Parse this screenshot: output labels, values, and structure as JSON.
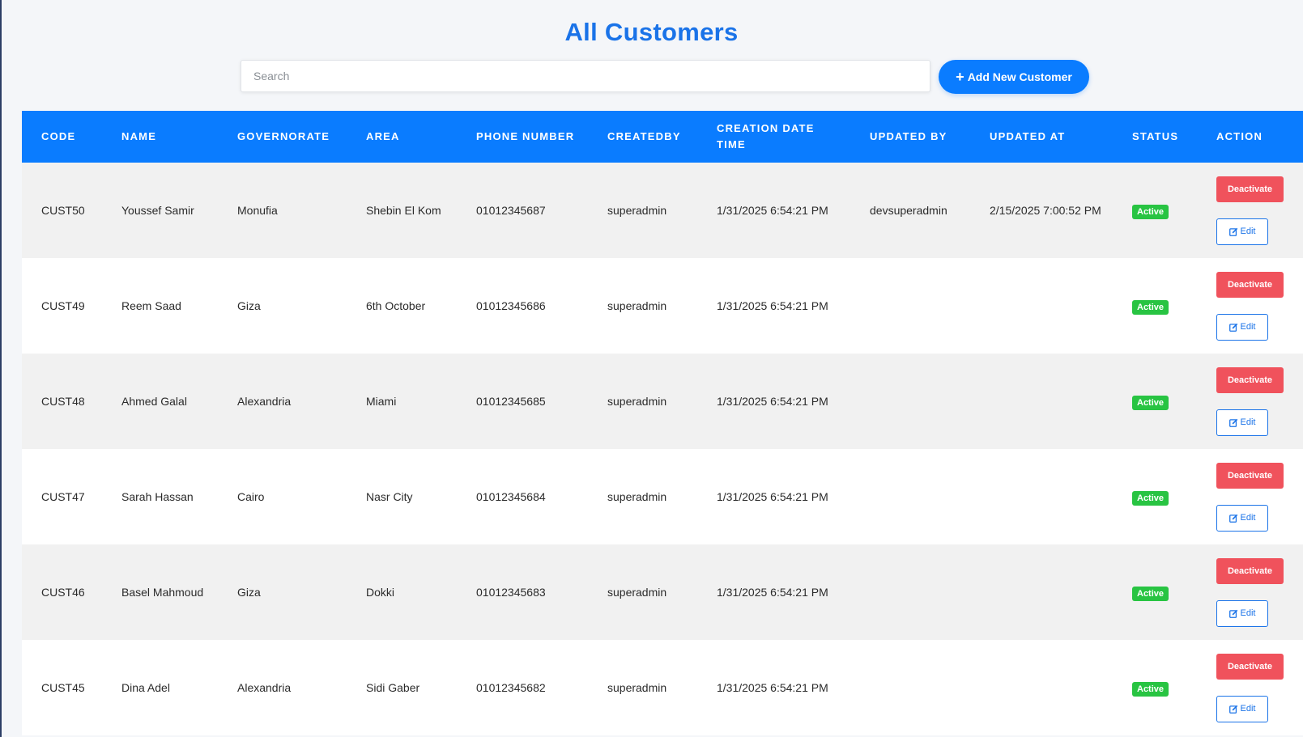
{
  "page": {
    "title": "All Customers"
  },
  "toolbar": {
    "search_placeholder": "Search",
    "search_value": "",
    "add_button_label": "Add New Customer",
    "add_button_icon": "plus-icon"
  },
  "colors": {
    "accent": "#0a7cff",
    "title": "#1a73e8",
    "active_badge": "#28c442",
    "deactivate": "#f0525c"
  },
  "table": {
    "columns": [
      "CODE",
      "NAME",
      "GOVERNORATE",
      "AREA",
      "PHONE NUMBER",
      "CREATEDBY",
      "CREATION DATE TIME",
      "UPDATED BY",
      "UPDATED AT",
      "STATUS",
      "ACTION"
    ],
    "deactivate_label": "Deactivate",
    "edit_label": "Edit",
    "rows": [
      {
        "code": "CUST50",
        "name": "Youssef Samir",
        "governorate": "Monufia",
        "area": "Shebin El Kom",
        "phone": "01012345687",
        "created_by": "superadmin",
        "created_at": "1/31/2025 6:54:21 PM",
        "updated_by": "devsuperadmin",
        "updated_at": "2/15/2025 7:00:52 PM",
        "status": "Active"
      },
      {
        "code": "CUST49",
        "name": "Reem Saad",
        "governorate": "Giza",
        "area": "6th October",
        "phone": "01012345686",
        "created_by": "superadmin",
        "created_at": "1/31/2025 6:54:21 PM",
        "updated_by": "",
        "updated_at": "",
        "status": "Active"
      },
      {
        "code": "CUST48",
        "name": "Ahmed Galal",
        "governorate": "Alexandria",
        "area": "Miami",
        "phone": "01012345685",
        "created_by": "superadmin",
        "created_at": "1/31/2025 6:54:21 PM",
        "updated_by": "",
        "updated_at": "",
        "status": "Active"
      },
      {
        "code": "CUST47",
        "name": "Sarah Hassan",
        "governorate": "Cairo",
        "area": "Nasr City",
        "phone": "01012345684",
        "created_by": "superadmin",
        "created_at": "1/31/2025 6:54:21 PM",
        "updated_by": "",
        "updated_at": "",
        "status": "Active"
      },
      {
        "code": "CUST46",
        "name": "Basel Mahmoud",
        "governorate": "Giza",
        "area": "Dokki",
        "phone": "01012345683",
        "created_by": "superadmin",
        "created_at": "1/31/2025 6:54:21 PM",
        "updated_by": "",
        "updated_at": "",
        "status": "Active"
      },
      {
        "code": "CUST45",
        "name": "Dina Adel",
        "governorate": "Alexandria",
        "area": "Sidi Gaber",
        "phone": "01012345682",
        "created_by": "superadmin",
        "created_at": "1/31/2025 6:54:21 PM",
        "updated_by": "",
        "updated_at": "",
        "status": "Active"
      }
    ]
  }
}
